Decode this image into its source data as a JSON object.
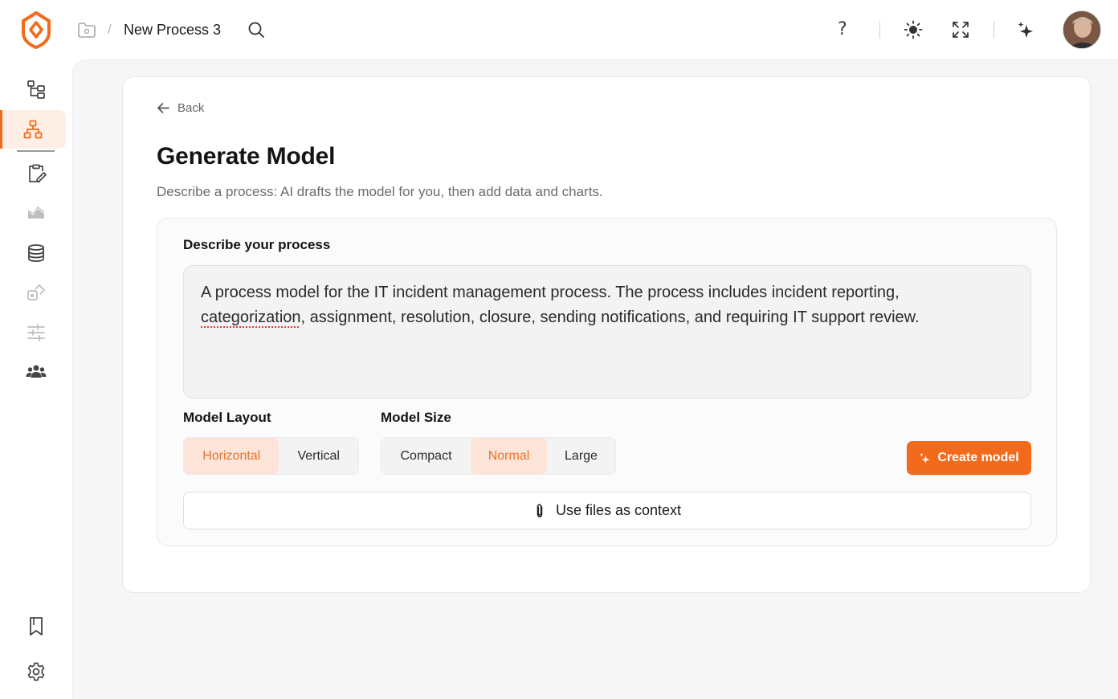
{
  "header": {
    "process_title": "New Process 3",
    "separator": "/",
    "help_label": "?"
  },
  "sidebar": {
    "items": [
      {
        "icon": "tree-structure-icon",
        "active": false
      },
      {
        "icon": "hierarchy-icon",
        "active": true
      },
      {
        "icon": "clipboard-edit-icon",
        "active": false
      },
      {
        "icon": "mountain-chart-icon",
        "active": false
      },
      {
        "icon": "database-icon",
        "active": false
      },
      {
        "icon": "share-box-icon",
        "active": false
      },
      {
        "icon": "sliders-icon",
        "active": false
      },
      {
        "icon": "users-icon",
        "active": false
      }
    ],
    "bottom": [
      {
        "icon": "bookmark-icon"
      },
      {
        "icon": "settings-gear-icon"
      }
    ]
  },
  "page": {
    "back_label": "Back",
    "title": "Generate Model",
    "subtitle": "Describe a process: AI drafts the model for you, then add data and charts."
  },
  "form": {
    "describe_label": "Describe your process",
    "description_text_before": "A process model for the IT incident management process. The process includes incident reporting,",
    "description_misspelled": "categorization",
    "description_text_after": ", assignment, resolution, closure, sending notifications, and requiring IT support review.",
    "layout_label": "Model Layout",
    "layout_options": [
      "Horizontal",
      "Vertical"
    ],
    "layout_selected": "Horizontal",
    "size_label": "Model Size",
    "size_options": [
      "Compact",
      "Normal",
      "Large"
    ],
    "size_selected": "Normal",
    "create_button": "Create model",
    "files_button": "Use files as context"
  },
  "colors": {
    "accent": "#f26a1b",
    "selected_bg": "#fce5d8",
    "selected_text": "#e8722d"
  }
}
